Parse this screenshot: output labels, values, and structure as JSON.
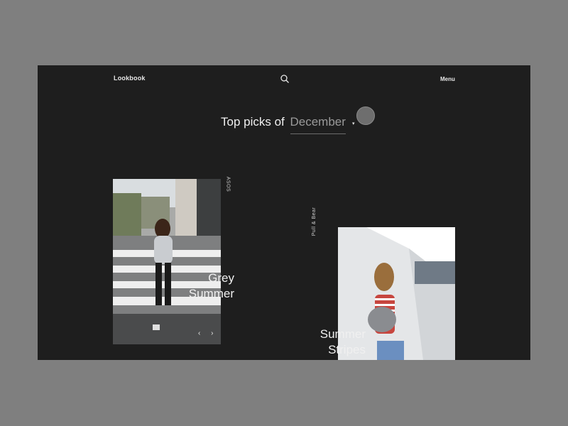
{
  "header": {
    "brand": "Lookbook",
    "menu_label": "Menu",
    "search_icon": "search-icon"
  },
  "hero": {
    "prefix": "Top picks of",
    "month": "December",
    "caret": "▾"
  },
  "cards": [
    {
      "brand": "ASOS",
      "title_line1": "Grey",
      "title_line2": "Summer",
      "nav": "‹ ›"
    },
    {
      "brand": "Pull & Bear",
      "title_line1": "Summer",
      "title_line2": "Stripes"
    }
  ],
  "colors": {
    "page_bg": "#7f7f7f",
    "frame_bg": "#1e1e1e",
    "text": "#f0f0f0",
    "muted_text": "#9a9a9a"
  }
}
